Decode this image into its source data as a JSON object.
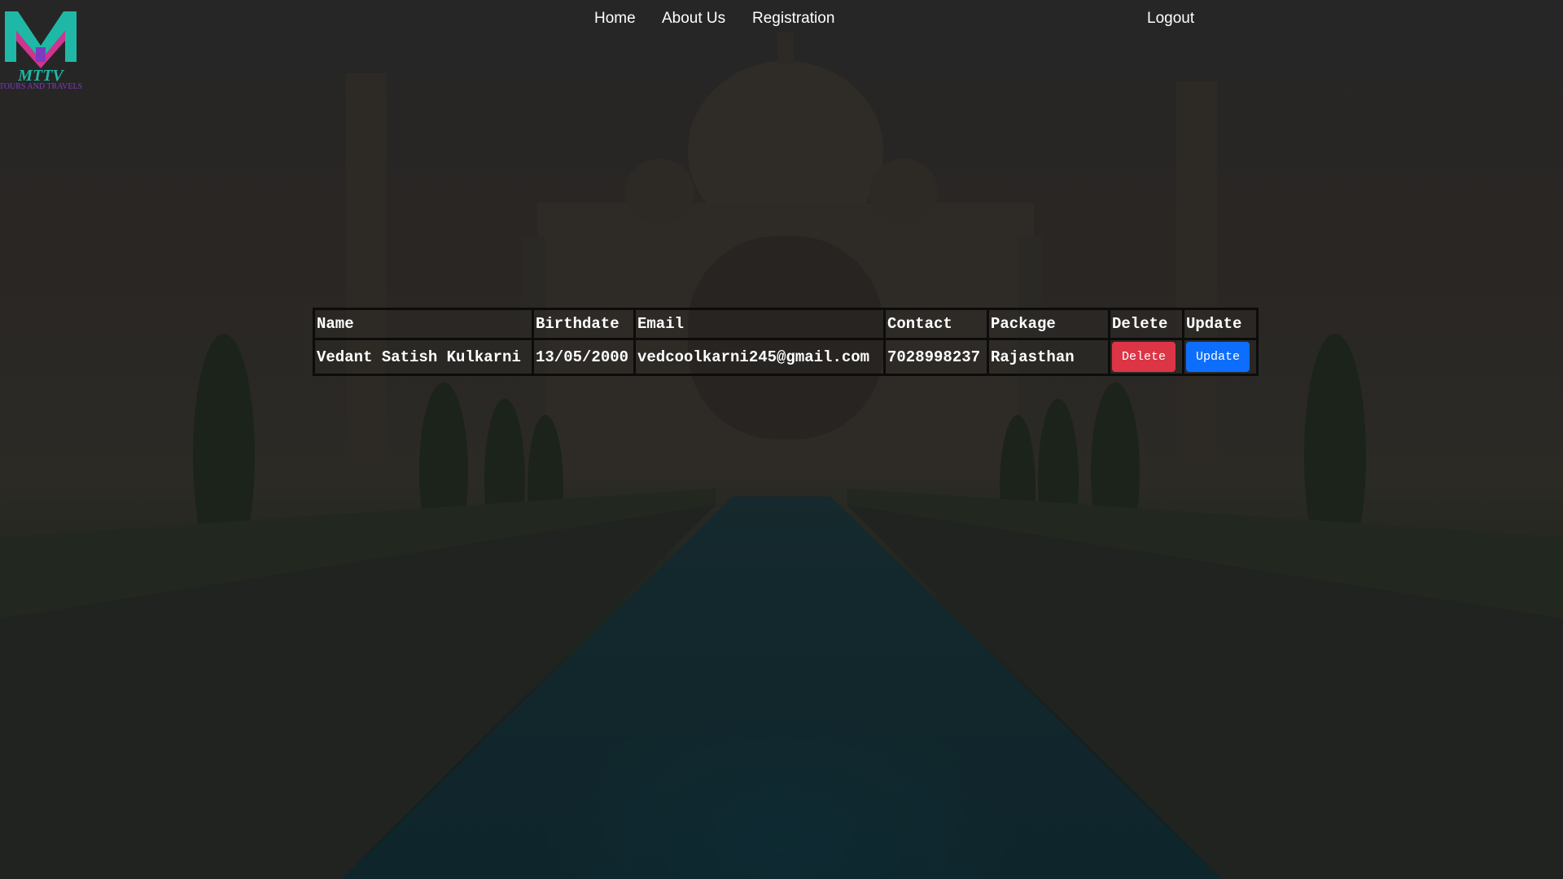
{
  "brand": {
    "logo_text": "MTTV",
    "logo_subtext": "TOURS AND TRAVELS",
    "colors": {
      "teal": "#1fb8a6",
      "magenta": "#d0348f",
      "purple": "#7d3cc0"
    }
  },
  "nav": {
    "home": "Home",
    "about": "About Us",
    "registration": "Registration",
    "logout": "Logout"
  },
  "table": {
    "headers": {
      "name": "Name",
      "birthdate": "Birthdate",
      "email": "Email",
      "contact": "Contact",
      "package": "Package",
      "delete": "Delete",
      "update": "Update"
    },
    "rows": [
      {
        "name": "Vedant Satish Kulkarni",
        "birthdate": "13/05/2000",
        "email": "vedcoolkarni245@gmail.com",
        "contact": "7028998237",
        "package": "Rajasthan",
        "delete_label": "Delete",
        "update_label": "Update"
      }
    ]
  },
  "colors": {
    "delete_button": "#dc3545",
    "update_button": "#0d6efd",
    "overlay": "#1b1b1b"
  }
}
